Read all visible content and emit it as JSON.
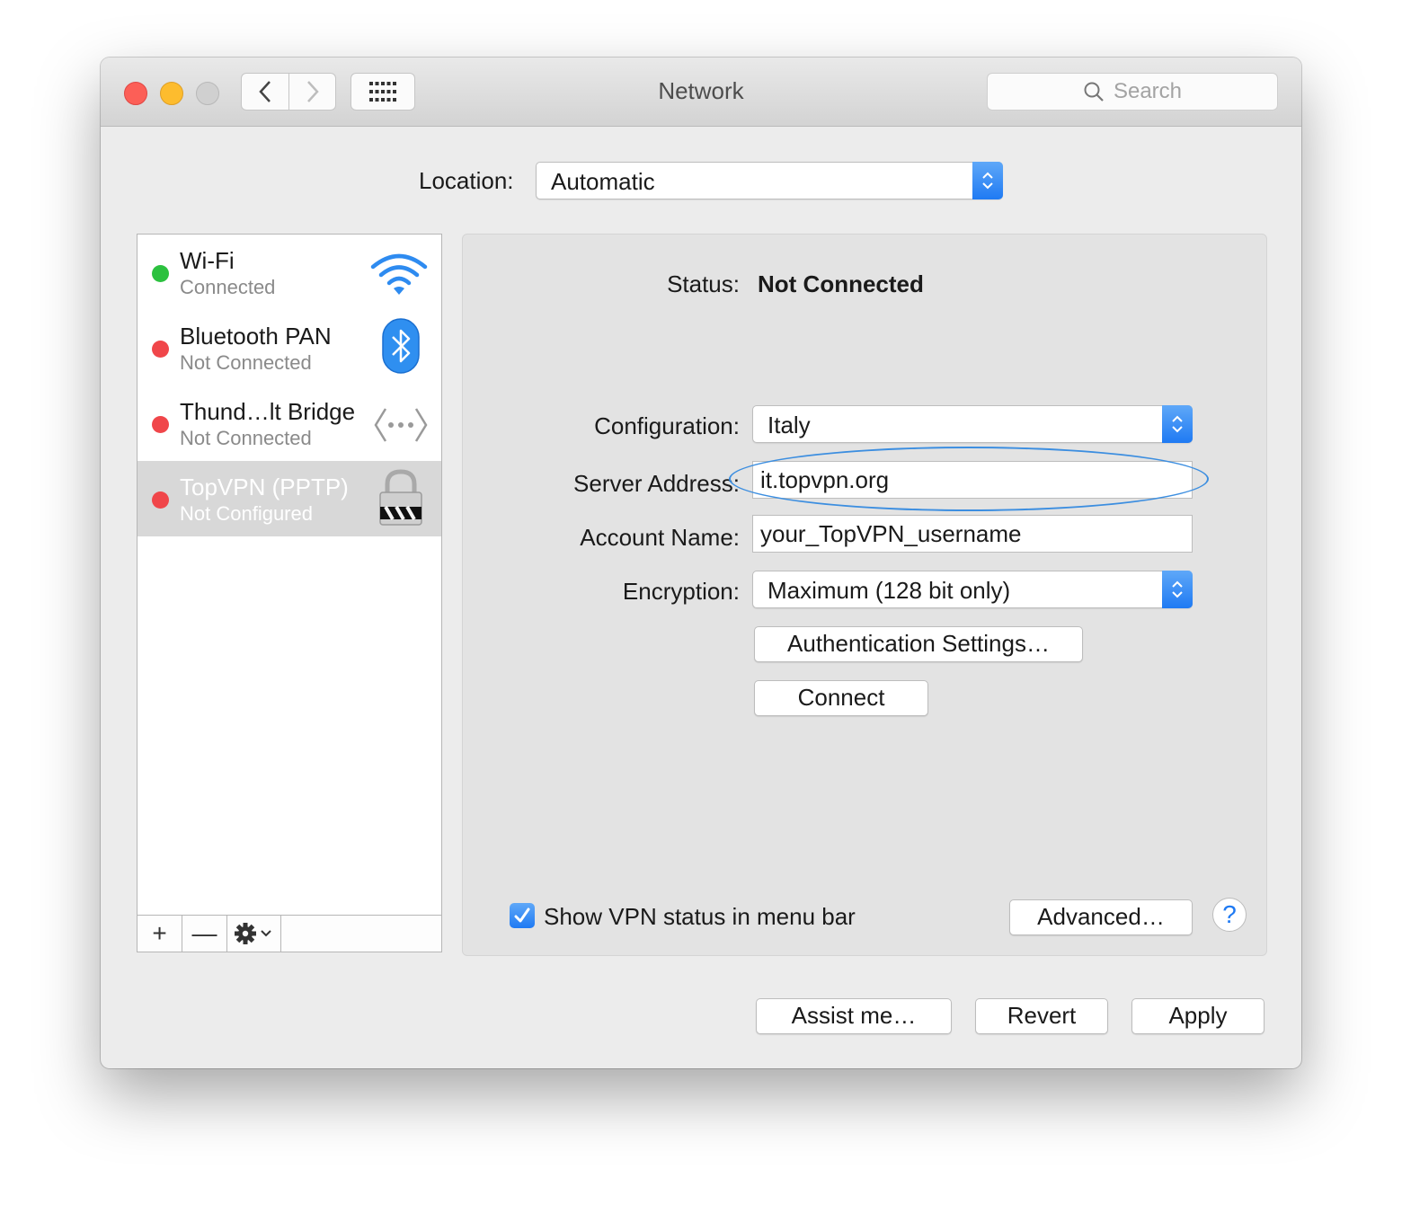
{
  "window": {
    "title": "Network"
  },
  "search": {
    "placeholder": "Search"
  },
  "location": {
    "label": "Location:",
    "value": "Automatic"
  },
  "services": [
    {
      "name": "Wi-Fi",
      "status": "Connected",
      "dot_color": "#2cc13f",
      "icon": "wifi-icon"
    },
    {
      "name": "Bluetooth PAN",
      "status": "Not Connected",
      "dot_color": "#f0464a",
      "icon": "bluetooth-icon"
    },
    {
      "name": "Thund…lt Bridge",
      "status": "Not Connected",
      "dot_color": "#f0464a",
      "icon": "thunderbolt-bridge-icon"
    },
    {
      "name": "TopVPN (PPTP)",
      "status": "Not Configured",
      "dot_color": "#f0464a",
      "icon": "vpn-lock-icon",
      "selected": true
    }
  ],
  "sidebar_toolbar": {
    "add": "+",
    "remove": "—"
  },
  "detail": {
    "status_label": "Status:",
    "status_value": "Not Connected",
    "configuration_label": "Configuration:",
    "configuration_value": "Italy",
    "server_label": "Server Address:",
    "server_value": "it.topvpn.org",
    "account_label": "Account Name:",
    "account_value": "your_TopVPN_username",
    "encryption_label": "Encryption:",
    "encryption_value": "Maximum (128 bit only)",
    "auth_button": "Authentication Settings…",
    "connect_button": "Connect",
    "show_status_label": "Show VPN status in menu bar",
    "show_status_checked": true,
    "advanced_button": "Advanced…",
    "help_button": "?"
  },
  "footer": {
    "assist": "Assist me…",
    "revert": "Revert",
    "apply": "Apply"
  },
  "colors": {
    "accent": "#1f7af3",
    "annotation": "#3c8ee0"
  }
}
